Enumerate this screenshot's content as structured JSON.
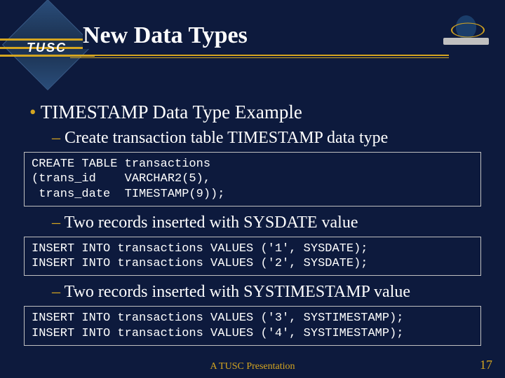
{
  "logo_text": "TUSC",
  "slide_title": "New Data Types",
  "bullets": {
    "main": "TIMESTAMP Data Type Example",
    "sub1": "Create transaction table TIMESTAMP data type",
    "sub2": "Two records inserted with SYSDATE value",
    "sub3": "Two records inserted with SYSTIMESTAMP value"
  },
  "code": {
    "block1": "CREATE TABLE transactions\n(trans_id    VARCHAR2(5),\n trans_date  TIMESTAMP(9));",
    "block2": "INSERT INTO transactions VALUES ('1', SYSDATE);\nINSERT INTO transactions VALUES ('2', SYSDATE);",
    "block3": "INSERT INTO transactions VALUES ('3', SYSTIMESTAMP);\nINSERT INTO transactions VALUES ('4', SYSTIMESTAMP);"
  },
  "footer": "A TUSC Presentation",
  "page": "17"
}
